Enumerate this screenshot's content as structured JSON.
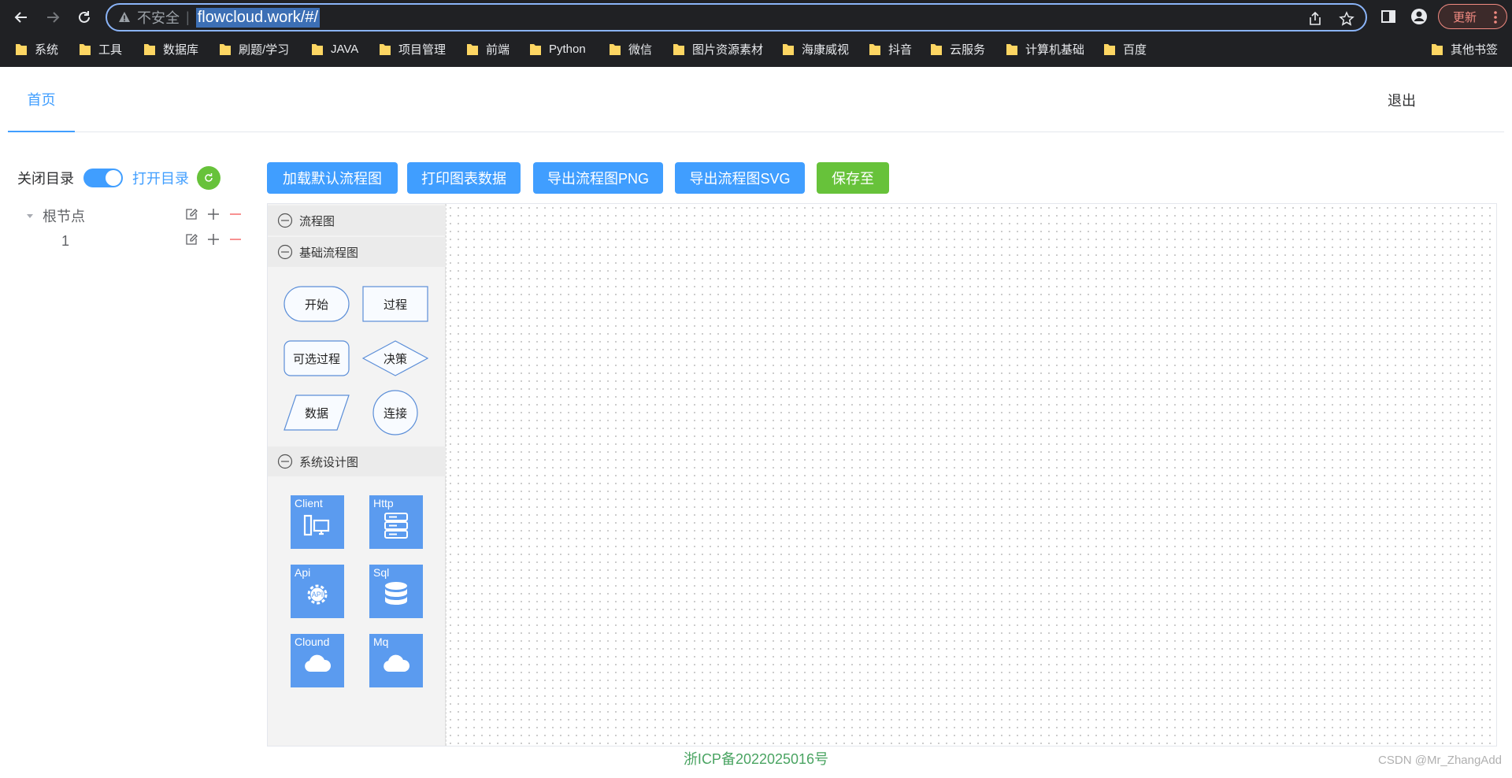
{
  "browser": {
    "address": {
      "security_label": "不安全",
      "separator": "|",
      "url": "flowcloud.work/#/"
    },
    "update_label": "更新",
    "bookmarks": [
      {
        "label": "系统"
      },
      {
        "label": "工具"
      },
      {
        "label": "数据库"
      },
      {
        "label": "刷题/学习"
      },
      {
        "label": "JAVA"
      },
      {
        "label": "项目管理"
      },
      {
        "label": "前端"
      },
      {
        "label": "Python"
      },
      {
        "label": "微信"
      },
      {
        "label": "图片资源素材"
      },
      {
        "label": "海康威视"
      },
      {
        "label": "抖音"
      },
      {
        "label": "云服务"
      },
      {
        "label": "计算机基础"
      },
      {
        "label": "百度"
      }
    ],
    "other_bookmarks": "其他书签"
  },
  "header": {
    "home_tab": "首页",
    "logout": "退出"
  },
  "directory": {
    "close_label": "关闭目录",
    "open_label": "打开目录",
    "switch_on": true,
    "tree": [
      {
        "label": "根节点"
      },
      {
        "label": "1"
      }
    ]
  },
  "actions": {
    "load_default": "加载默认流程图",
    "print_data": "打印图表数据",
    "export_png": "导出流程图PNG",
    "export_svg": "导出流程图SVG",
    "save_to": "保存至"
  },
  "palette": {
    "groups": {
      "flowchart": "流程图",
      "basic_flowchart": "基础流程图",
      "system_design": "系统设计图"
    },
    "basic_shapes": {
      "start": "开始",
      "process": "过程",
      "optional_process": "可选过程",
      "decision": "决策",
      "data": "数据",
      "connector": "连接"
    },
    "system_shapes": {
      "client": "Client",
      "http": "Http",
      "api": "Api",
      "sql": "Sql",
      "cloud": "Clound",
      "mq": "Mq"
    }
  },
  "footer": {
    "icp": "浙ICP备2022025016号",
    "watermark": "CSDN @Mr_ZhangAdd"
  },
  "colors": {
    "primary": "#409eff",
    "success": "#67c23a",
    "tile": "#5b9bef"
  }
}
